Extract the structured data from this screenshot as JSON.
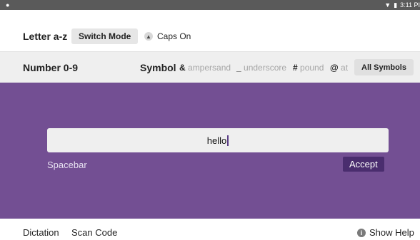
{
  "status_bar": {
    "time": "3:11 PI"
  },
  "keyboard": {
    "letter_label": "Letter a-z",
    "switch_mode_label": "Switch Mode",
    "caps_label": "Caps On",
    "number_label": "Number 0-9",
    "symbol_label": "Symbol",
    "symbols": [
      {
        "char": "&",
        "name": "ampersand"
      },
      {
        "char": "_",
        "name": "underscore"
      },
      {
        "char": "#",
        "name": "pound"
      },
      {
        "char": "@",
        "name": "at"
      }
    ],
    "all_symbols_label": "All Symbols"
  },
  "input": {
    "value": "hello",
    "spacebar_label": "Spacebar",
    "accept_label": "Accept"
  },
  "footer": {
    "dictation_label": "Dictation",
    "scan_code_label": "Scan Code",
    "show_help_label": "Show Help"
  },
  "colors": {
    "panel": "#734f93",
    "accept": "#4a2d6e",
    "status_bar": "#5a5a5a"
  }
}
